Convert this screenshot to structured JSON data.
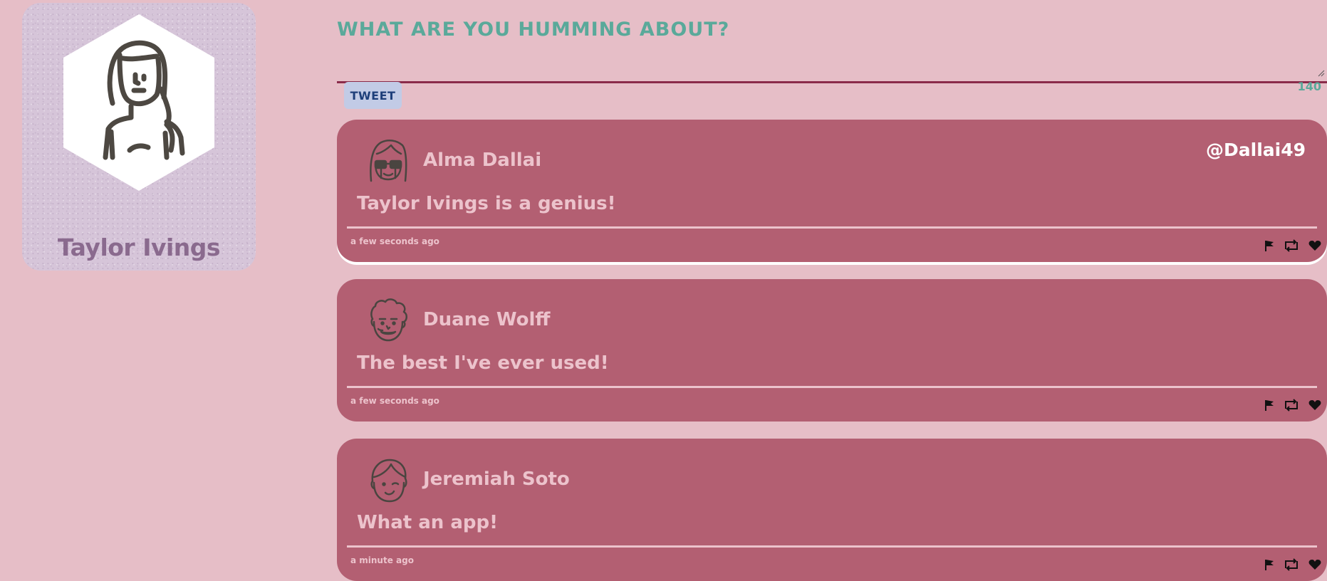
{
  "profile": {
    "name": "Taylor Ivings"
  },
  "compose": {
    "title": "What are you humming about?",
    "value": "",
    "char_count": "140",
    "tweet_button_label": "Tweet"
  },
  "tweets": [
    {
      "author": "Alma Dallai",
      "handle": "@Dallai49",
      "text": "Taylor Ivings is a genius!",
      "time": "a few seconds ago",
      "avatar_icon": "woman-sunglasses-avatar-icon"
    },
    {
      "author": "Duane Wolff",
      "handle": "",
      "text": "The best I've ever used!",
      "time": "a few seconds ago",
      "avatar_icon": "man-curly-hair-avatar-icon"
    },
    {
      "author": "Jeremiah Soto",
      "handle": "",
      "text": "What an app!",
      "time": "a minute ago",
      "avatar_icon": "man-winking-avatar-icon"
    }
  ],
  "colors": {
    "page_background": "#e6bec7",
    "tweet_background": "#b35f72",
    "accent_teal": "#5aa99a",
    "profile_name": "#8a6a8e",
    "button_background": "#c2cbe6",
    "button_text": "#1e3f7a"
  }
}
